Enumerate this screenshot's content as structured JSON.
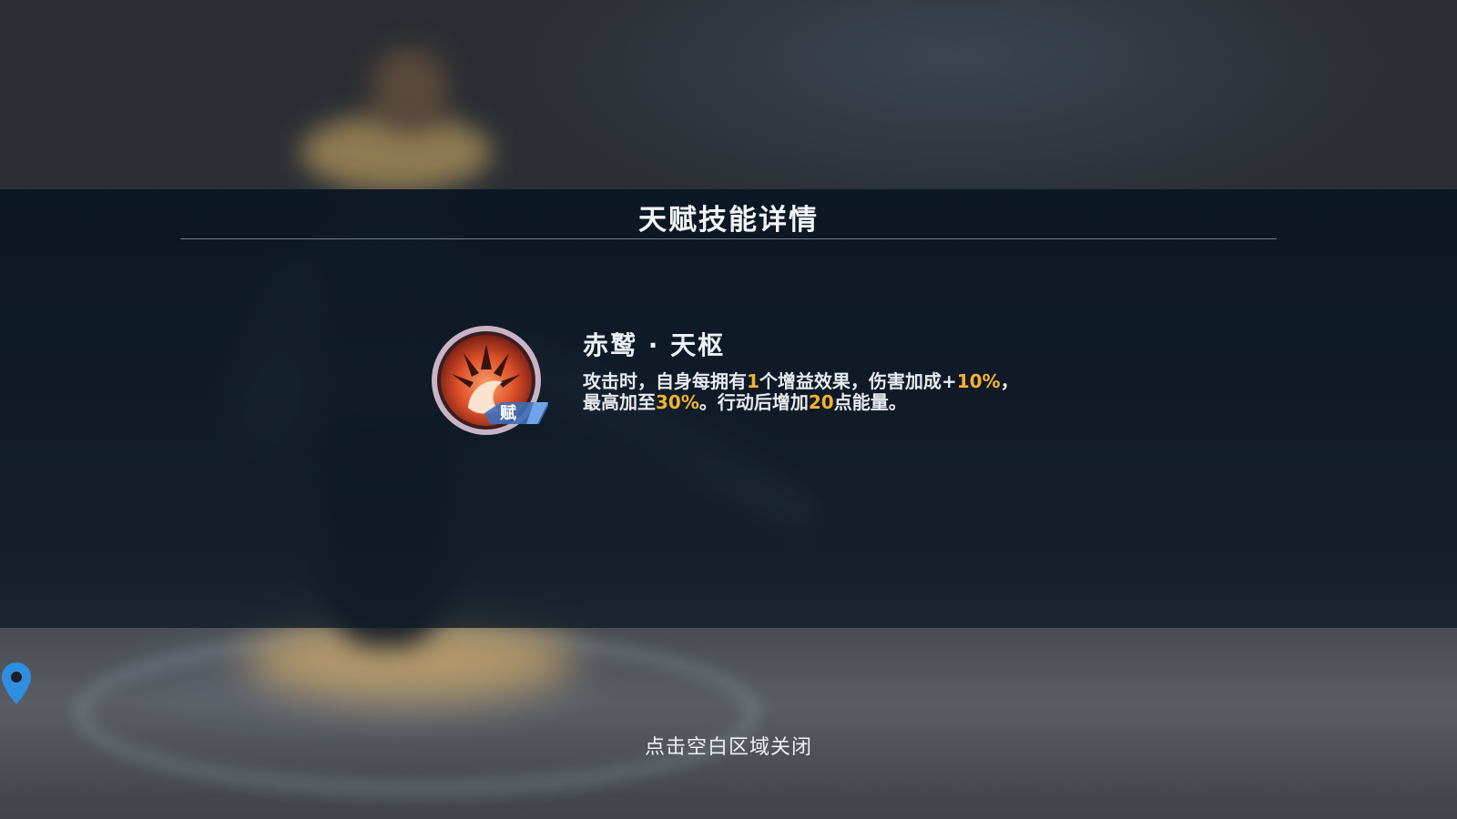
{
  "panel": {
    "title": "天赋技能详情"
  },
  "skill": {
    "badge": "赋",
    "name": "赤鹫 · 天枢",
    "description": {
      "t1": "攻击时，自身每拥有",
      "v1": "1",
      "t2": "个增益效果，伤害加成+",
      "v2": "10%",
      "t3": "，最高加至",
      "v3": "30%",
      "t4": "。行动后增加",
      "v4": "20",
      "t5": "点能量。"
    }
  },
  "hint": {
    "close": "点击空白区域关闭"
  },
  "icons": {
    "skill": "flame-talent-icon",
    "location": "map-pin-icon"
  },
  "colors": {
    "highlight": "#f2b233",
    "pin": "#2f8ee0",
    "icon_core": "#e0522a"
  }
}
